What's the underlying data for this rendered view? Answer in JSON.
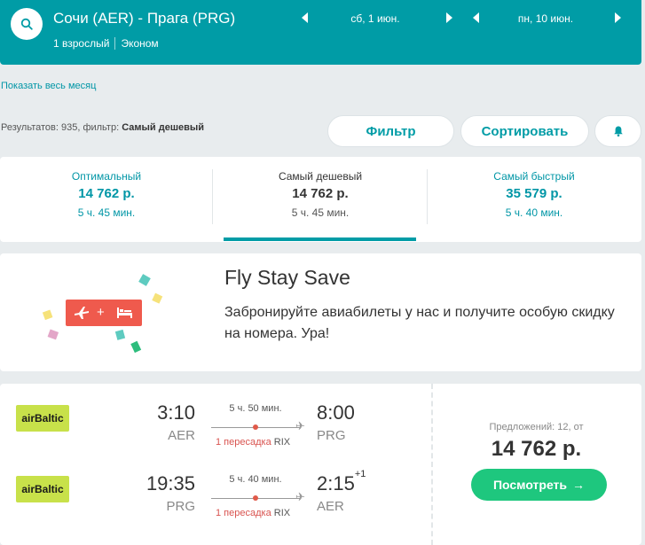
{
  "header": {
    "route": "Сочи (AER) - Прага (PRG)",
    "passengers": "1 взрослый",
    "cabin": "Эконом",
    "depart_date": "сб, 1 июн.",
    "return_date": "пн, 10 июн.",
    "icons": {
      "search": "search-icon",
      "prev": "chevron-left-icon",
      "next": "chevron-right-icon"
    }
  },
  "month_link": "Показать весь месяц",
  "results": {
    "prefix": "Результатов: 935, фильтр:",
    "filter": "Самый дешевый"
  },
  "toolbar": {
    "filter_label": "Фильтр",
    "sort_label": "Сортировать",
    "alert_icon": "bell-icon"
  },
  "tabs": [
    {
      "title": "Оптимальный",
      "price": "14 762 р.",
      "duration": "5 ч. 45 мин."
    },
    {
      "title": "Самый дешевый",
      "price": "14 762 р.",
      "duration": "5 ч. 45 мин."
    },
    {
      "title": "Самый быстрый",
      "price": "35 579 р.",
      "duration": "5 ч. 40 мин."
    }
  ],
  "promo": {
    "title": "Fly Stay Save",
    "text": "Забронируйте авиабилеты у нас и получите особую скидку на номера. Ура!",
    "badge_plus": "+",
    "icons": {
      "plane": "plane-icon",
      "bed": "bed-icon"
    }
  },
  "ticket": {
    "legs": [
      {
        "airline": "airBaltic",
        "dep_time": "3:10",
        "dep_code": "AER",
        "duration": "5 ч. 50 мин.",
        "stops": "1 пересадка",
        "via": "RIX",
        "arr_time": "8:00",
        "arr_code": "PRG",
        "day_offset": ""
      },
      {
        "airline": "airBaltic",
        "dep_time": "19:35",
        "dep_code": "PRG",
        "duration": "5 ч. 40 мин.",
        "stops": "1 пересадка",
        "via": "RIX",
        "arr_time": "2:15",
        "arr_code": "AER",
        "day_offset": "+1"
      }
    ],
    "offers": "Предложений: 12, от",
    "price": "14 762 р.",
    "view_label": "Посмотреть",
    "view_arrow": "→"
  },
  "colors": {
    "brand": "#009ca6",
    "cta": "#1ec77e",
    "stop": "#d9534f"
  }
}
